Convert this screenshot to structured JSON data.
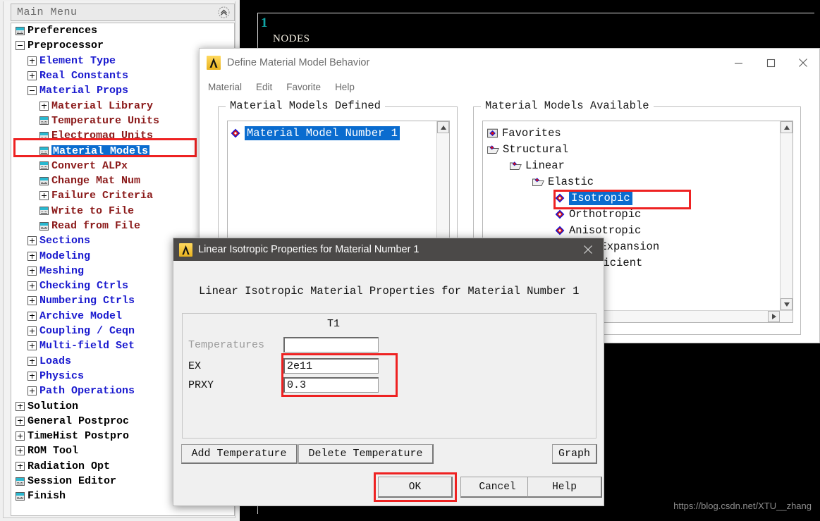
{
  "graphics": {
    "plot_number": "1",
    "plot_label": "NODES",
    "watermark": "https://blog.csdn.net/XTU__zhang"
  },
  "sidebar": {
    "title": "Main Menu",
    "collapse_icon": "double-chevron-up-icon",
    "tree": [
      {
        "label": "Preferences",
        "indent": 0,
        "marker": "doc",
        "color": "black"
      },
      {
        "label": "Preprocessor",
        "indent": 0,
        "marker": "minus",
        "color": "black"
      },
      {
        "label": "Element Type",
        "indent": 1,
        "marker": "plus",
        "color": "blue"
      },
      {
        "label": "Real Constants",
        "indent": 1,
        "marker": "plus",
        "color": "blue"
      },
      {
        "label": "Material Props",
        "indent": 1,
        "marker": "minus",
        "color": "blue"
      },
      {
        "label": "Material Library",
        "indent": 2,
        "marker": "plus",
        "color": "dred"
      },
      {
        "label": "Temperature Units",
        "indent": 2,
        "marker": "doc",
        "color": "dred"
      },
      {
        "label": "Electromag Units",
        "indent": 2,
        "marker": "doc",
        "color": "dred"
      },
      {
        "label": "Material Models",
        "indent": 2,
        "marker": "doc",
        "color": "dred",
        "selected": true
      },
      {
        "label": "Convert ALPx",
        "indent": 2,
        "marker": "doc",
        "color": "dred"
      },
      {
        "label": "Change Mat Num",
        "indent": 2,
        "marker": "doc",
        "color": "dred"
      },
      {
        "label": "Failure Criteria",
        "indent": 2,
        "marker": "plus",
        "color": "dred"
      },
      {
        "label": "Write to File",
        "indent": 2,
        "marker": "doc",
        "color": "dred"
      },
      {
        "label": "Read from File",
        "indent": 2,
        "marker": "doc",
        "color": "dred"
      },
      {
        "label": "Sections",
        "indent": 1,
        "marker": "plus",
        "color": "blue"
      },
      {
        "label": "Modeling",
        "indent": 1,
        "marker": "plus",
        "color": "blue"
      },
      {
        "label": "Meshing",
        "indent": 1,
        "marker": "plus",
        "color": "blue"
      },
      {
        "label": "Checking Ctrls",
        "indent": 1,
        "marker": "plus",
        "color": "blue"
      },
      {
        "label": "Numbering Ctrls",
        "indent": 1,
        "marker": "plus",
        "color": "blue"
      },
      {
        "label": "Archive Model",
        "indent": 1,
        "marker": "plus",
        "color": "blue"
      },
      {
        "label": "Coupling / Ceqn",
        "indent": 1,
        "marker": "plus",
        "color": "blue"
      },
      {
        "label": "Multi-field Set",
        "indent": 1,
        "marker": "plus",
        "color": "blue"
      },
      {
        "label": "Loads",
        "indent": 1,
        "marker": "plus",
        "color": "blue"
      },
      {
        "label": "Physics",
        "indent": 1,
        "marker": "plus",
        "color": "blue"
      },
      {
        "label": "Path Operations",
        "indent": 1,
        "marker": "plus",
        "color": "blue"
      },
      {
        "label": "Solution",
        "indent": 0,
        "marker": "plus",
        "color": "black"
      },
      {
        "label": "General Postproc",
        "indent": 0,
        "marker": "plus",
        "color": "black"
      },
      {
        "label": "TimeHist Postpro",
        "indent": 0,
        "marker": "plus",
        "color": "black"
      },
      {
        "label": "ROM Tool",
        "indent": 0,
        "marker": "plus",
        "color": "black"
      },
      {
        "label": "Radiation Opt",
        "indent": 0,
        "marker": "plus",
        "color": "black"
      },
      {
        "label": "Session Editor",
        "indent": 0,
        "marker": "doc",
        "color": "black"
      },
      {
        "label": "Finish",
        "indent": 0,
        "marker": "doc",
        "color": "black"
      }
    ]
  },
  "define_material_window": {
    "title": "Define Material Model Behavior",
    "menus": [
      "Material",
      "Edit",
      "Favorite",
      "Help"
    ],
    "window_buttons": {
      "minimize": "minimize-icon",
      "maximize": "maximize-icon",
      "close": "close-icon"
    },
    "defined_panel": {
      "title": "Material Models Defined",
      "items": [
        {
          "label": "Material Model Number 1",
          "icon": "diamond",
          "indent": 0,
          "selected": true
        }
      ]
    },
    "available_panel": {
      "title": "Material Models Available",
      "items": [
        {
          "label": "Favorites",
          "icon": "favorites",
          "indent": 0,
          "selected": false
        },
        {
          "label": "Structural",
          "icon": "folder",
          "indent": 0,
          "selected": false
        },
        {
          "label": "Linear",
          "icon": "folder",
          "indent": 1,
          "selected": false
        },
        {
          "label": "Elastic",
          "icon": "folder",
          "indent": 2,
          "selected": false
        },
        {
          "label": "Isotropic",
          "icon": "diamond",
          "indent": 3,
          "selected": true
        },
        {
          "label": "Orthotropic",
          "icon": "diamond",
          "indent": 3,
          "selected": false
        },
        {
          "label": "Anisotropic",
          "icon": "diamond",
          "indent": 3,
          "selected": false
        },
        {
          "label": "Thermal Expansion",
          "icon": "folder",
          "indent": 2,
          "selected": false
        },
        {
          "label": "Coefficient",
          "icon": "folder",
          "indent": 3,
          "selected": false
        }
      ]
    }
  },
  "linear_isotropic_dialog": {
    "title": "Linear Isotropic Properties for Material Number 1",
    "heading": "Linear Isotropic Material Properties for Material Number 1",
    "column_header": "T1",
    "rows": [
      {
        "name": "Temperatures",
        "value": "",
        "dim": true
      },
      {
        "name": "EX",
        "value": "2e11",
        "dim": false
      },
      {
        "name": "PRXY",
        "value": "0.3",
        "dim": false
      }
    ],
    "toolbar": {
      "add_temperature": "Add Temperature",
      "delete_temperature": "Delete Temperature",
      "graph": "Graph"
    },
    "footer": {
      "ok": "OK",
      "cancel": "Cancel",
      "help": "Help"
    },
    "close_icon": "close-icon"
  },
  "highlights": {
    "accent_color": "#ee2222",
    "selection_color": "#0a6ccf"
  }
}
